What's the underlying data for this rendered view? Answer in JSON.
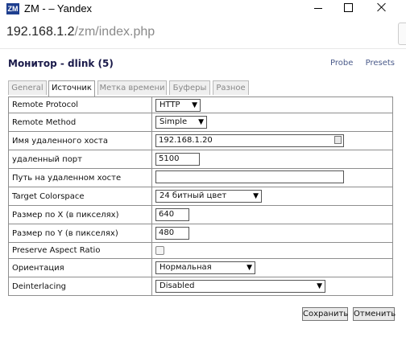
{
  "window": {
    "logo_text": "ZM",
    "title": "ZM - – Yandex"
  },
  "browser": {
    "url_host": "192.168.1.2",
    "url_path": "/zm/index.php"
  },
  "page": {
    "title": "Монитор - dlink (5)",
    "links": {
      "probe": "Probe",
      "presets": "Presets"
    }
  },
  "tabs": [
    {
      "label": "General",
      "active": false
    },
    {
      "label": "Источник",
      "active": true
    },
    {
      "label": "Метка времени",
      "active": false
    },
    {
      "label": "Буферы",
      "active": false
    },
    {
      "label": "Разное",
      "active": false
    }
  ],
  "form": {
    "remote_protocol": {
      "label": "Remote Protocol",
      "value": "HTTP"
    },
    "remote_method": {
      "label": "Remote Method",
      "value": "Simple"
    },
    "remote_host": {
      "label": "Имя удаленного хоста",
      "value": "192.168.1.20"
    },
    "remote_port": {
      "label": "удаленный порт",
      "value": "5100"
    },
    "remote_path": {
      "label": "Путь на удаленном хосте",
      "value": ""
    },
    "colorspace": {
      "label": "Target Colorspace",
      "value": "24 битный цвет"
    },
    "width": {
      "label": "Размер по X (в пикселях)",
      "value": "640"
    },
    "height": {
      "label": "Размер по Y (в пикселях)",
      "value": "480"
    },
    "aspect": {
      "label": "Preserve Aspect Ratio",
      "checked": false
    },
    "orientation": {
      "label": "Ориентация",
      "value": "Нормальная"
    },
    "deinterlacing": {
      "label": "Deinterlacing",
      "value": "Disabled"
    }
  },
  "buttons": {
    "save": "Сохранить",
    "cancel": "Отменить"
  }
}
